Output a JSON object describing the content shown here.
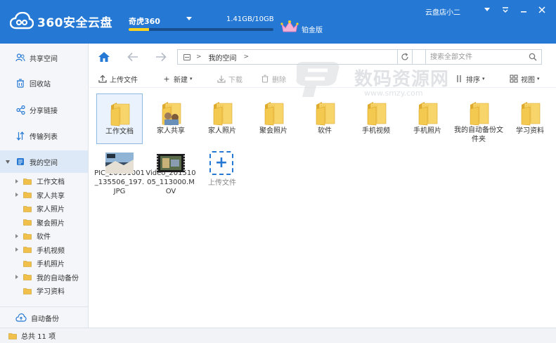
{
  "app": {
    "title": "360安全云盘",
    "colors": {
      "brand": "#2579d4",
      "quota_fill": "#ffd21e",
      "folder": "#f5c84c"
    }
  },
  "header": {
    "user_name": "奇虎360",
    "quota": "1.41GB/10GB",
    "quota_used_fraction": 0.141,
    "vip_label": "铂金版",
    "account_name": "云盘店小二",
    "window_buttons": [
      "menu-icon",
      "pin-icon",
      "minimize-icon",
      "close-icon"
    ]
  },
  "sidebar": {
    "items": [
      {
        "label": "共享空间",
        "icon": "users-icon"
      },
      {
        "label": "回收站",
        "icon": "recycle-bin-icon"
      },
      {
        "label": "分享链接",
        "icon": "share-icon"
      },
      {
        "label": "传输列表",
        "icon": "transfer-icon"
      },
      {
        "label": "我的空间",
        "icon": "my-space-icon"
      }
    ],
    "tree": [
      {
        "label": "工作文档",
        "expandable": true
      },
      {
        "label": "家人共享",
        "expandable": true
      },
      {
        "label": "家人照片",
        "expandable": false
      },
      {
        "label": "聚会照片",
        "expandable": false
      },
      {
        "label": "软件",
        "expandable": true
      },
      {
        "label": "手机视频",
        "expandable": true
      },
      {
        "label": "手机照片",
        "expandable": false
      },
      {
        "label": "我的自动备份",
        "expandable": true
      },
      {
        "label": "学习资料",
        "expandable": false
      }
    ],
    "auto_backup": "自动备份"
  },
  "addressbar": {
    "path": "我的空间",
    "search_placeholder": "搜索全部文件"
  },
  "toolbar": {
    "upload": "上传文件",
    "new": "新建",
    "download": "下载",
    "delete": "删除",
    "sort": "排序",
    "view": "视图"
  },
  "files": [
    {
      "name": "工作文档",
      "type": "folder"
    },
    {
      "name": "家人共享",
      "type": "shared-folder"
    },
    {
      "name": "家人照片",
      "type": "folder"
    },
    {
      "name": "聚会照片",
      "type": "folder"
    },
    {
      "name": "软件",
      "type": "folder"
    },
    {
      "name": "手机视频",
      "type": "folder"
    },
    {
      "name": "手机照片",
      "type": "folder"
    },
    {
      "name": "我的自动备份文件夹",
      "type": "folder"
    },
    {
      "name": "学习资料",
      "type": "folder"
    },
    {
      "name": "PIC_20151001_135506_197.JPG",
      "type": "image"
    },
    {
      "name": "Video_20151005_113000.MOV",
      "type": "video"
    },
    {
      "name": "上传文件",
      "type": "upload"
    }
  ],
  "status": {
    "text": "总共 11 项"
  },
  "watermark": {
    "text": "数码资源网",
    "url": "www.smzy.com"
  }
}
